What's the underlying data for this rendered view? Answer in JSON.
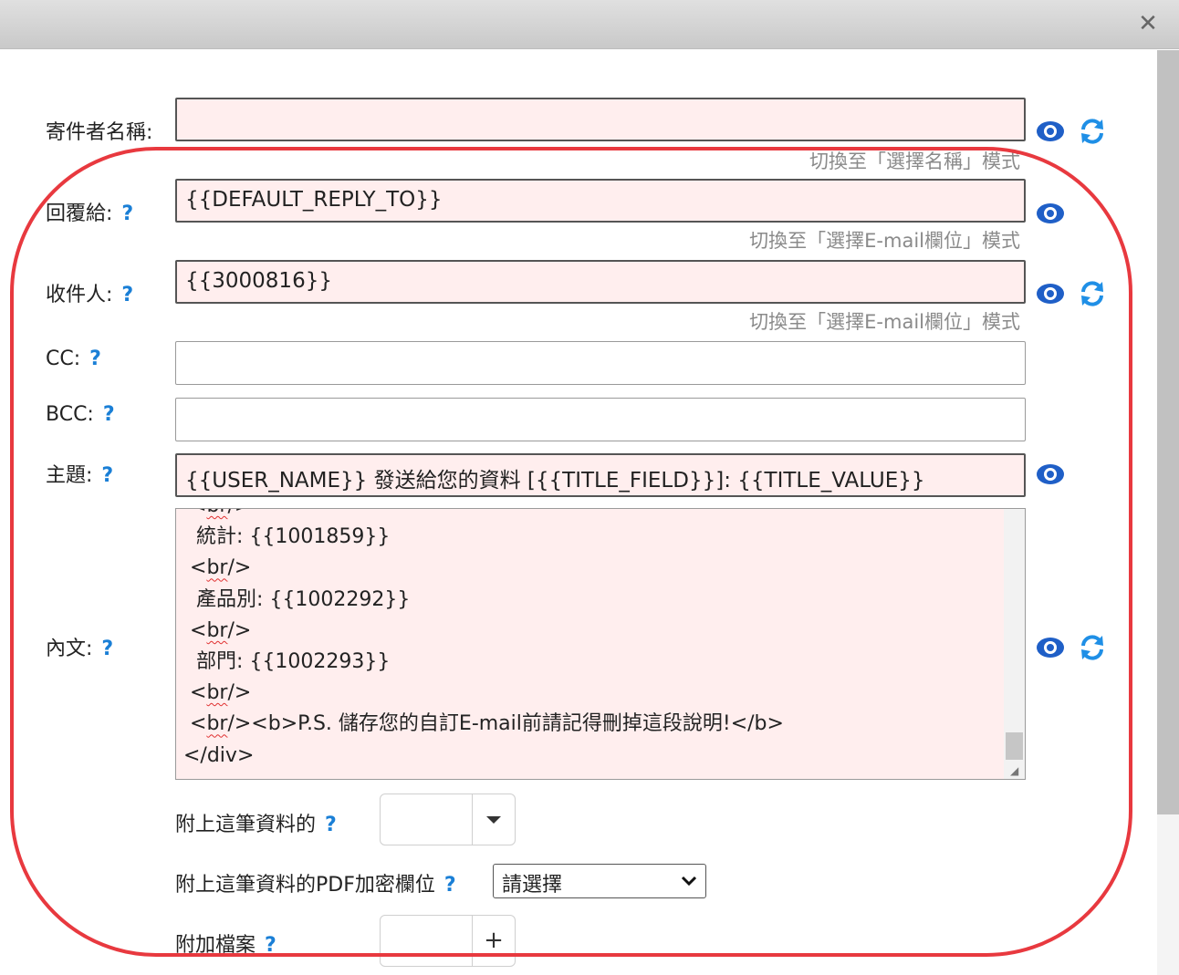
{
  "window": {
    "close_icon": "close-icon"
  },
  "sender_name": {
    "label": "寄件者名稱:",
    "value": "",
    "hint": "切換至「選擇名稱」模式"
  },
  "reply_to": {
    "label": "回覆給:",
    "help": "?",
    "value": "{{DEFAULT_REPLY_TO}}",
    "hint": "切換至「選擇E-mail欄位」模式"
  },
  "recipient": {
    "label": "收件人:",
    "help": "?",
    "value": "{{3000816}}",
    "hint": "切換至「選擇E-mail欄位」模式"
  },
  "cc": {
    "label": "CC:",
    "help": "?",
    "value": ""
  },
  "bcc": {
    "label": "BCC:",
    "help": "?",
    "value": ""
  },
  "subject": {
    "label": "主題:",
    "help": "?",
    "value": "{{USER_NAME}} 發送給您的資料 [{{TITLE_FIELD}}]: {{TITLE_VALUE}}"
  },
  "content": {
    "label": "內文:",
    "help": "?",
    "lines": [
      {
        "pre": " <",
        "tag": "br",
        "post": "/>"
      },
      {
        "pre": "  統計: {{1001859}}",
        "tag": "",
        "post": ""
      },
      {
        "pre": " <",
        "tag": "br",
        "post": "/>"
      },
      {
        "pre": "  產品別: {{1002292}}",
        "tag": "",
        "post": ""
      },
      {
        "pre": " <",
        "tag": "br",
        "post": "/>"
      },
      {
        "pre": "  部門: {{1002293}}",
        "tag": "",
        "post": ""
      },
      {
        "pre": " <",
        "tag": "br",
        "post": "/>"
      },
      {
        "pre": " <",
        "tag": "br",
        "post": "/><b>P.S. 儲存您的自訂E-mail前請記得刪掉這段說明!</b>"
      },
      {
        "pre": "</div>",
        "tag": "",
        "post": ""
      }
    ]
  },
  "attach_record": {
    "label": "附上這筆資料的",
    "help": "?",
    "value": ""
  },
  "pdf_encrypt": {
    "label": "附上這筆資料的PDF加密欄位",
    "help": "?",
    "selected": "請選擇"
  },
  "attachment": {
    "label": "附加檔案",
    "help": "?",
    "add_symbol": "+"
  },
  "colors": {
    "accent_blue": "#1f5fc7",
    "required_bg": "#ffeeee",
    "annotation_red": "#e8393f",
    "help_blue": "#1a7fd6"
  }
}
